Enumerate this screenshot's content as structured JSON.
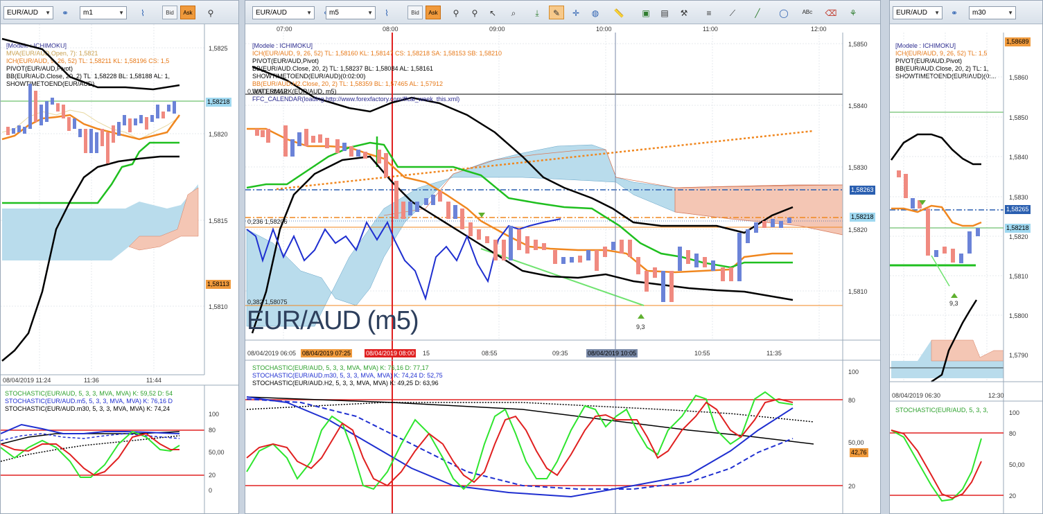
{
  "left": {
    "symbol": "EUR/AUD",
    "timeframe": "m1",
    "bid_label": "Bid",
    "ask_label": "Ask",
    "legend": [
      {
        "text": "[Modele : ICHIMOKU]",
        "color": "#2b2b8f"
      },
      {
        "text": "MVA(EUR/AUD.Open, 7): 1,5821",
        "color": "#c8a050"
      },
      {
        "text": "ICH(EUR/AUD, 9, 26, 52)  TL: 1,58211  KL: 1,58196  CS: 1,5",
        "color": "#e67817"
      },
      {
        "text": "PIVOT(EUR/AUD,Pivot)",
        "color": "#000"
      },
      {
        "text": "BB(EUR/AUD.Close, 20, 2)  TL: 1,58228  BL: 1,58188  AL: 1,",
        "color": "#000"
      },
      {
        "text": "SHOWTIMETOEND(EUR/AUD)",
        "color": "#000"
      }
    ],
    "price_ticks": [
      "1,5825",
      "1,5820",
      "1,5815",
      "1,5810"
    ],
    "tag_current": "1,58218",
    "tag_low": "1,58113",
    "time_ticks": [
      "08/04/2019 11:24",
      "11:36",
      "11:44"
    ],
    "osc_legend": [
      {
        "text": "STOCHASTIC(EUR/AUD, 5, 3, 3, MVA, MVA)  K: 59,52  D: 54",
        "color": "#2ca02c"
      },
      {
        "text": "STOCHASTIC(EUR/AUD.m5, 5, 3, 3, MVA, MVA)  K: 76,16  D",
        "color": "#1f2fd0"
      },
      {
        "text": "STOCHASTIC(EUR/AUD.m30, 5, 3, 3, MVA, MVA)  K: 74,24",
        "color": "#000"
      }
    ],
    "osc_ticks": [
      "100",
      "80",
      "50,00",
      "20",
      "0"
    ]
  },
  "middle": {
    "symbol": "EUR/AUD",
    "timeframe": "m5",
    "bid_label": "Bid",
    "ask_label": "Ask",
    "top_times": [
      "07:00",
      "08:00",
      "09:00",
      "10:00",
      "11:00",
      "12:00"
    ],
    "legend": [
      {
        "text": "[Modele : ICHIMOKU]",
        "color": "#2b2b8f"
      },
      {
        "text": "ICH(EUR/AUD, 9, 26, 52)  TL: 1,58160  KL: 1,58147  CS: 1,58218  SA: 1,58153  SB: 1,58210",
        "color": "#e67817"
      },
      {
        "text": "PIVOT(EUR/AUD,Pivot)",
        "color": "#000"
      },
      {
        "text": "BB(EUR/AUD.Close, 20, 2)  TL: 1,58237  BL: 1,58084  AL: 1,58161",
        "color": "#000"
      },
      {
        "text": "SHOWTIMETOEND(EUR/AUD)(0:02:00)",
        "color": "#000"
      },
      {
        "text": "BB(EUR/AUD.H2.Close, 20, 2)  TL: 1,58359  BL: 1,57465  AL: 1,57912",
        "color": "#e67817"
      },
      {
        "text": "WATERMARK(EUR/AUD, m5)",
        "color": "#000"
      },
      {
        "text": "FFC_CALENDAR(loading http://www.forexfactory.com/ffcal_week_this.xml)",
        "color": "#2b2b8f"
      }
    ],
    "fibo": [
      "0,000 1,58412",
      "0,236 1,58206",
      "0,382 1,58075"
    ],
    "watermark": "EUR/AUD (m5)",
    "price_ticks": [
      "1,5850",
      "1,5840",
      "1,5830",
      "1,5820",
      "1,5810"
    ],
    "tag_pivot": "1,58263",
    "tag_current": "1,58218",
    "signal_label": "9,3",
    "bottom_times": [
      "08/04/2019 06:05",
      "08:55",
      "09:35",
      "10:55",
      "11:35"
    ],
    "tag_time1": "08/04/2019 07:25",
    "tag_time2": "08/04/2019 08:00",
    "tag_time3": "08/04/2019 10:05",
    "tag_time2_suffix": "15",
    "osc_legend": [
      {
        "text": "STOCHASTIC(EUR/AUD, 5, 3, 3, MVA, MVA)  K: 76,16  D: 77,17",
        "color": "#2ca02c"
      },
      {
        "text": "STOCHASTIC(EUR/AUD.m30, 5, 3, 3, MVA, MVA)  K: 74,24  D: 52,75",
        "color": "#1f2fd0"
      },
      {
        "text": "STOCHASTIC(EUR/AUD.H2, 5, 3, 3, MVA, MVA)  K: 49,25  D: 63,96",
        "color": "#000"
      }
    ],
    "osc_ticks": [
      "100",
      "80",
      "50,00",
      "20"
    ],
    "osc_tag": "42,76"
  },
  "right": {
    "symbol": "EUR/AUD",
    "timeframe": "m30",
    "legend": [
      {
        "text": "[Modele : ICHIMOKU]",
        "color": "#2b2b8f"
      },
      {
        "text": "ICH(EUR/AUD, 9, 26, 52)  TL: 1,5",
        "color": "#e67817"
      },
      {
        "text": "PIVOT(EUR/AUD,Pivot)",
        "color": "#000"
      },
      {
        "text": "BB(EUR/AUD.Close, 20, 2)  TL: 1,",
        "color": "#000"
      },
      {
        "text": "SHOWTIMETOEND(EUR/AUD)(0:...",
        "color": "#000"
      }
    ],
    "price_ticks": [
      "1,5860",
      "1,5850",
      "1,5840",
      "1,5830",
      "1,5820",
      "1,5810",
      "1,5800",
      "1,5790"
    ],
    "tag_top": "1,58689",
    "tag_pivot": "1,58265",
    "tag_current": "1,58218",
    "signal_label": "9,3",
    "time_ticks": [
      "08/04/2019 06:30",
      "12:30"
    ],
    "osc_legend": [
      {
        "text": "STOCHASTIC(EUR/AUD, 5, 3, 3,",
        "color": "#2ca02c"
      }
    ],
    "osc_ticks": [
      "100",
      "80",
      "50,00",
      "20"
    ]
  }
}
